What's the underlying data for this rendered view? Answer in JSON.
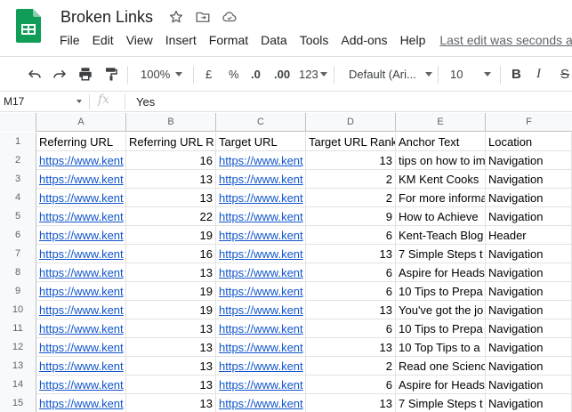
{
  "doc": {
    "title": "Broken Links",
    "last_edit": "Last edit was seconds ago"
  },
  "menu": [
    "File",
    "Edit",
    "View",
    "Insert",
    "Format",
    "Data",
    "Tools",
    "Add-ons",
    "Help"
  ],
  "toolbar": {
    "zoom": "100%",
    "currency": "£",
    "percent": "%",
    "dec_less": ".0",
    "dec_more": ".00",
    "more_formats": "123",
    "font": "Default (Ari...",
    "font_size": "10",
    "bold": "B",
    "italic": "I",
    "strike": "S"
  },
  "formula": {
    "cell_ref": "M17",
    "fx": "fx",
    "value": "Yes"
  },
  "columns": [
    "A",
    "B",
    "C",
    "D",
    "E",
    "F"
  ],
  "rows": [
    {
      "num": "1",
      "a": "Referring URL",
      "b": "Referring URL R",
      "c": "Target URL",
      "d": "Target URL Rank",
      "e": "Anchor Text",
      "f": "Location",
      "header": true
    },
    {
      "num": "2",
      "a": "https://www.kent",
      "b": "16",
      "c": "https://www.kent",
      "d": "13",
      "e": "tips on how to im",
      "f": "Navigation"
    },
    {
      "num": "3",
      "a": "https://www.kent",
      "b": "13",
      "c": "https://www.kent",
      "d": "2",
      "e": "KM Kent Cooks",
      "f": "Navigation"
    },
    {
      "num": "4",
      "a": "https://www.kent",
      "b": "13",
      "c": "https://www.kent",
      "d": "2",
      "e": "For more informa",
      "f": "Navigation"
    },
    {
      "num": "5",
      "a": "https://www.kent",
      "b": "22",
      "c": "https://www.kent",
      "d": "9",
      "e": "How to Achieve",
      "f": "Navigation"
    },
    {
      "num": "6",
      "a": "https://www.kent",
      "b": "19",
      "c": "https://www.kent",
      "d": "6",
      "e": "Kent-Teach Blog",
      "f": "Header"
    },
    {
      "num": "7",
      "a": "https://www.kent",
      "b": "16",
      "c": "https://www.kent",
      "d": "13",
      "e": "7 Simple Steps t",
      "f": "Navigation"
    },
    {
      "num": "8",
      "a": "https://www.kent",
      "b": "13",
      "c": "https://www.kent",
      "d": "6",
      "e": "Aspire for Heads",
      "f": "Navigation"
    },
    {
      "num": "9",
      "a": "https://www.kent",
      "b": "19",
      "c": "https://www.kent",
      "d": "6",
      "e": "10 Tips to Prepa",
      "f": "Navigation"
    },
    {
      "num": "10",
      "a": "https://www.kent",
      "b": "19",
      "c": "https://www.kent",
      "d": "13",
      "e": "You've got the jo",
      "f": "Navigation"
    },
    {
      "num": "11",
      "a": "https://www.kent",
      "b": "13",
      "c": "https://www.kent",
      "d": "6",
      "e": "10 Tips to Prepa",
      "f": "Navigation"
    },
    {
      "num": "12",
      "a": "https://www.kent",
      "b": "13",
      "c": "https://www.kent",
      "d": "13",
      "e": "10 Top Tips to a",
      "f": "Navigation"
    },
    {
      "num": "13",
      "a": "https://www.kent",
      "b": "13",
      "c": "https://www.kent",
      "d": "2",
      "e": "Read one Scienc",
      "f": "Navigation"
    },
    {
      "num": "14",
      "a": "https://www.kent",
      "b": "13",
      "c": "https://www.kent",
      "d": "6",
      "e": "Aspire for Heads",
      "f": "Navigation"
    },
    {
      "num": "15",
      "a": "https://www.kent",
      "b": "13",
      "c": "https://www.kent",
      "d": "13",
      "e": "7 Simple Steps t",
      "f": "Navigation"
    }
  ],
  "colors": {
    "sheets_green": "#0f9d58",
    "link_blue": "#1155cc",
    "header_bg": "#f8f9fa"
  }
}
